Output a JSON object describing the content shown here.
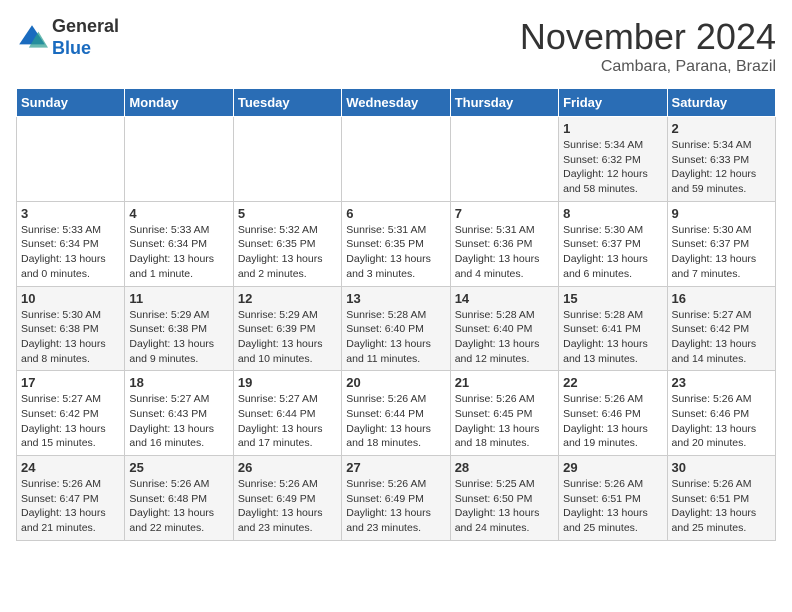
{
  "logo": {
    "line1": "General",
    "line2": "Blue"
  },
  "title": "November 2024",
  "subtitle": "Cambara, Parana, Brazil",
  "weekdays": [
    "Sunday",
    "Monday",
    "Tuesday",
    "Wednesday",
    "Thursday",
    "Friday",
    "Saturday"
  ],
  "weeks": [
    [
      {
        "day": "",
        "info": ""
      },
      {
        "day": "",
        "info": ""
      },
      {
        "day": "",
        "info": ""
      },
      {
        "day": "",
        "info": ""
      },
      {
        "day": "",
        "info": ""
      },
      {
        "day": "1",
        "info": "Sunrise: 5:34 AM\nSunset: 6:32 PM\nDaylight: 12 hours\nand 58 minutes."
      },
      {
        "day": "2",
        "info": "Sunrise: 5:34 AM\nSunset: 6:33 PM\nDaylight: 12 hours\nand 59 minutes."
      }
    ],
    [
      {
        "day": "3",
        "info": "Sunrise: 5:33 AM\nSunset: 6:34 PM\nDaylight: 13 hours\nand 0 minutes."
      },
      {
        "day": "4",
        "info": "Sunrise: 5:33 AM\nSunset: 6:34 PM\nDaylight: 13 hours\nand 1 minute."
      },
      {
        "day": "5",
        "info": "Sunrise: 5:32 AM\nSunset: 6:35 PM\nDaylight: 13 hours\nand 2 minutes."
      },
      {
        "day": "6",
        "info": "Sunrise: 5:31 AM\nSunset: 6:35 PM\nDaylight: 13 hours\nand 3 minutes."
      },
      {
        "day": "7",
        "info": "Sunrise: 5:31 AM\nSunset: 6:36 PM\nDaylight: 13 hours\nand 4 minutes."
      },
      {
        "day": "8",
        "info": "Sunrise: 5:30 AM\nSunset: 6:37 PM\nDaylight: 13 hours\nand 6 minutes."
      },
      {
        "day": "9",
        "info": "Sunrise: 5:30 AM\nSunset: 6:37 PM\nDaylight: 13 hours\nand 7 minutes."
      }
    ],
    [
      {
        "day": "10",
        "info": "Sunrise: 5:30 AM\nSunset: 6:38 PM\nDaylight: 13 hours\nand 8 minutes."
      },
      {
        "day": "11",
        "info": "Sunrise: 5:29 AM\nSunset: 6:38 PM\nDaylight: 13 hours\nand 9 minutes."
      },
      {
        "day": "12",
        "info": "Sunrise: 5:29 AM\nSunset: 6:39 PM\nDaylight: 13 hours\nand 10 minutes."
      },
      {
        "day": "13",
        "info": "Sunrise: 5:28 AM\nSunset: 6:40 PM\nDaylight: 13 hours\nand 11 minutes."
      },
      {
        "day": "14",
        "info": "Sunrise: 5:28 AM\nSunset: 6:40 PM\nDaylight: 13 hours\nand 12 minutes."
      },
      {
        "day": "15",
        "info": "Sunrise: 5:28 AM\nSunset: 6:41 PM\nDaylight: 13 hours\nand 13 minutes."
      },
      {
        "day": "16",
        "info": "Sunrise: 5:27 AM\nSunset: 6:42 PM\nDaylight: 13 hours\nand 14 minutes."
      }
    ],
    [
      {
        "day": "17",
        "info": "Sunrise: 5:27 AM\nSunset: 6:42 PM\nDaylight: 13 hours\nand 15 minutes."
      },
      {
        "day": "18",
        "info": "Sunrise: 5:27 AM\nSunset: 6:43 PM\nDaylight: 13 hours\nand 16 minutes."
      },
      {
        "day": "19",
        "info": "Sunrise: 5:27 AM\nSunset: 6:44 PM\nDaylight: 13 hours\nand 17 minutes."
      },
      {
        "day": "20",
        "info": "Sunrise: 5:26 AM\nSunset: 6:44 PM\nDaylight: 13 hours\nand 18 minutes."
      },
      {
        "day": "21",
        "info": "Sunrise: 5:26 AM\nSunset: 6:45 PM\nDaylight: 13 hours\nand 18 minutes."
      },
      {
        "day": "22",
        "info": "Sunrise: 5:26 AM\nSunset: 6:46 PM\nDaylight: 13 hours\nand 19 minutes."
      },
      {
        "day": "23",
        "info": "Sunrise: 5:26 AM\nSunset: 6:46 PM\nDaylight: 13 hours\nand 20 minutes."
      }
    ],
    [
      {
        "day": "24",
        "info": "Sunrise: 5:26 AM\nSunset: 6:47 PM\nDaylight: 13 hours\nand 21 minutes."
      },
      {
        "day": "25",
        "info": "Sunrise: 5:26 AM\nSunset: 6:48 PM\nDaylight: 13 hours\nand 22 minutes."
      },
      {
        "day": "26",
        "info": "Sunrise: 5:26 AM\nSunset: 6:49 PM\nDaylight: 13 hours\nand 23 minutes."
      },
      {
        "day": "27",
        "info": "Sunrise: 5:26 AM\nSunset: 6:49 PM\nDaylight: 13 hours\nand 23 minutes."
      },
      {
        "day": "28",
        "info": "Sunrise: 5:25 AM\nSunset: 6:50 PM\nDaylight: 13 hours\nand 24 minutes."
      },
      {
        "day": "29",
        "info": "Sunrise: 5:26 AM\nSunset: 6:51 PM\nDaylight: 13 hours\nand 25 minutes."
      },
      {
        "day": "30",
        "info": "Sunrise: 5:26 AM\nSunset: 6:51 PM\nDaylight: 13 hours\nand 25 minutes."
      }
    ]
  ]
}
